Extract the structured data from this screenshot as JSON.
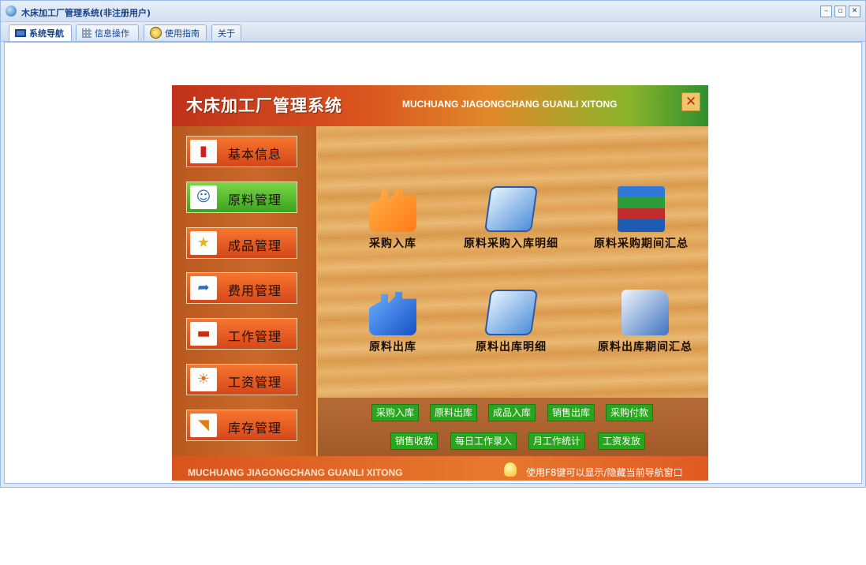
{
  "window": {
    "title": "木床加工厂管理系统(非注册用户)",
    "tabs": [
      {
        "label": "系统导航",
        "icon": "monitor-icon"
      },
      {
        "label": "信息操作",
        "icon": "grid-icon"
      },
      {
        "label": "使用指南",
        "icon": "help-globe-icon"
      },
      {
        "label": "关于",
        "icon": ""
      }
    ],
    "controls": {
      "minimize": "–",
      "restore": "▫",
      "close": "✕"
    }
  },
  "panel": {
    "title_cn": "木床加工厂管理系统",
    "title_en": "MUCHUANG JIAGONGCHANG GUANLI XITONG",
    "close_label": "✕",
    "sidebar": [
      {
        "label": "基本信息",
        "icon": "monitor-alert-icon",
        "active": false
      },
      {
        "label": "原料管理",
        "icon": "contact-card-icon",
        "active": true
      },
      {
        "label": "成品管理",
        "icon": "star-icon",
        "active": false
      },
      {
        "label": "费用管理",
        "icon": "arrow-right-icon",
        "active": false
      },
      {
        "label": "工作管理",
        "icon": "monitor-icon",
        "active": false
      },
      {
        "label": "工资管理",
        "icon": "flame-icon",
        "active": false
      },
      {
        "label": "库存管理",
        "icon": "rss-icon",
        "active": false
      }
    ],
    "features": [
      {
        "label": "采购入库",
        "icon": "factory-icon"
      },
      {
        "label": "原料采购入库明细",
        "icon": "pen-document-icon"
      },
      {
        "label": "原料采购期间汇总",
        "icon": "books-icon"
      },
      {
        "label": "原料出库",
        "icon": "factory-blue-icon"
      },
      {
        "label": "原料出库明细",
        "icon": "pen-document-icon"
      },
      {
        "label": "原料出库期间汇总",
        "icon": "folder-icon"
      }
    ],
    "quick_links": [
      "采购入库",
      "原料出库",
      "成品入库",
      "销售出库",
      "采购付款",
      "销售收款",
      "每日工作录入",
      "月工作统计",
      "工资发放"
    ],
    "footer_en": "MUCHUANG JIAGONGCHANG GUANLI XITONG",
    "footer_tip": "使用F8键可以显示/隐藏当前导航窗口"
  }
}
